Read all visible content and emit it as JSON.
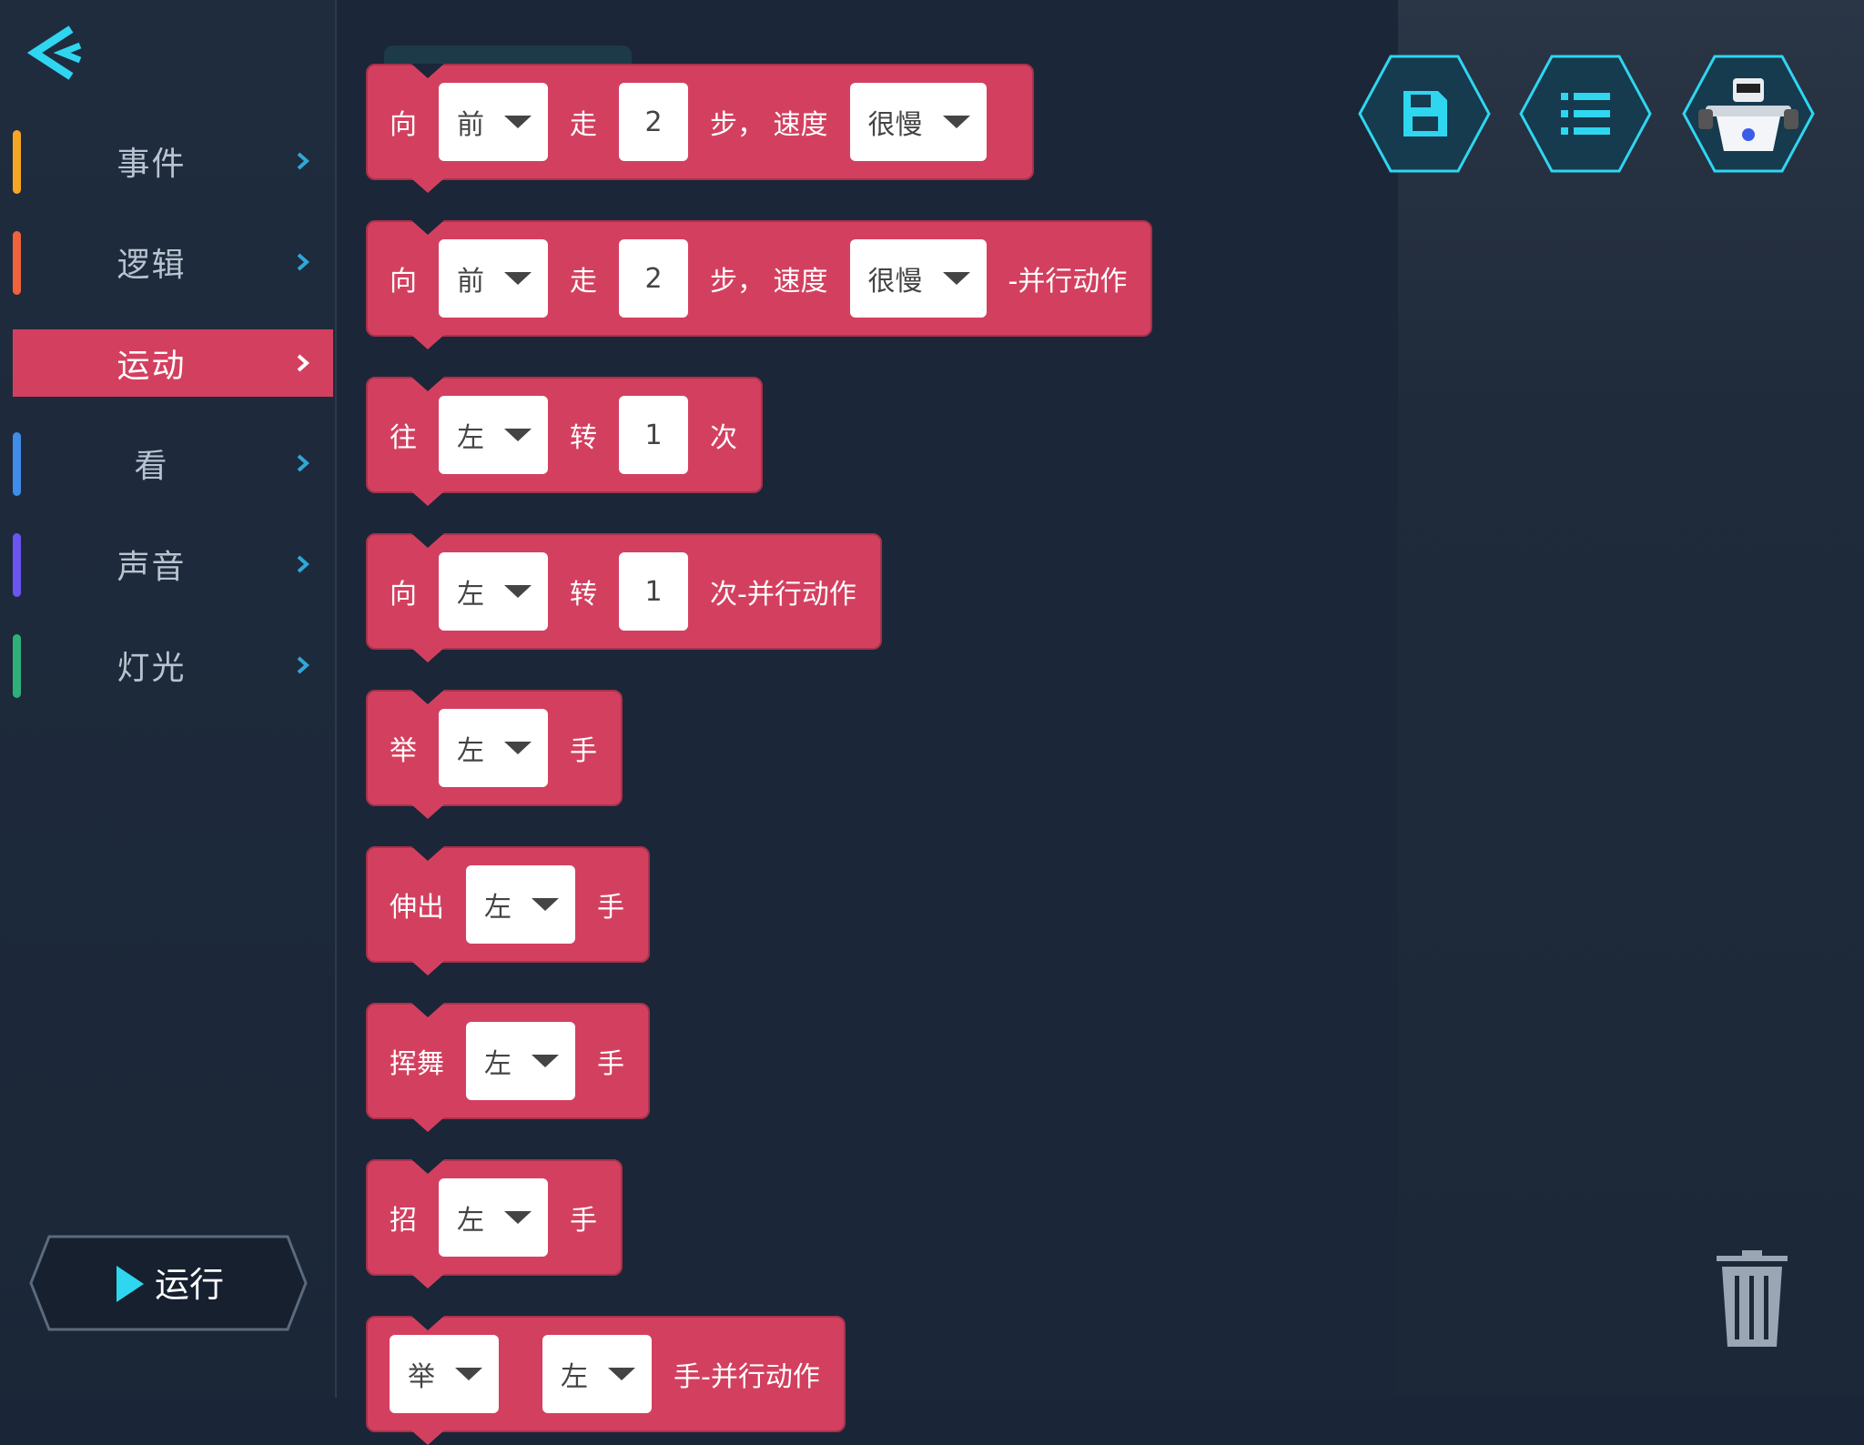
{
  "sidebar": {
    "categories": [
      {
        "label": "事件",
        "color": "#f5a623"
      },
      {
        "label": "逻辑",
        "color": "#f0623a"
      },
      {
        "label": "运动",
        "color": "#d3405f",
        "active": true
      },
      {
        "label": "看",
        "color": "#3f8de8"
      },
      {
        "label": "声音",
        "color": "#6a55f0"
      },
      {
        "label": "灯光",
        "color": "#2fb07a"
      }
    ],
    "run_label": "运行"
  },
  "toolbar": {
    "icons": [
      "save-icon",
      "list-icon",
      "robot-avatar-icon"
    ],
    "accent": "#2fd6f0"
  },
  "blocks": [
    {
      "parts": [
        {
          "t": "text",
          "v": "向"
        },
        {
          "t": "dropdown",
          "v": "前"
        },
        {
          "t": "text",
          "v": "走"
        },
        {
          "t": "number",
          "v": "2"
        },
        {
          "t": "text",
          "v": "步，  速度"
        },
        {
          "t": "dropdown",
          "v": "很慢"
        }
      ]
    },
    {
      "parts": [
        {
          "t": "text",
          "v": "向"
        },
        {
          "t": "dropdown",
          "v": "前"
        },
        {
          "t": "text",
          "v": "走"
        },
        {
          "t": "number",
          "v": "2"
        },
        {
          "t": "text",
          "v": "步，  速度"
        },
        {
          "t": "dropdown",
          "v": "很慢"
        },
        {
          "t": "text",
          "v": "-并行动作"
        }
      ]
    },
    {
      "parts": [
        {
          "t": "text",
          "v": "往"
        },
        {
          "t": "dropdown",
          "v": "左"
        },
        {
          "t": "text",
          "v": "转"
        },
        {
          "t": "number",
          "v": "1"
        },
        {
          "t": "text",
          "v": "次"
        }
      ]
    },
    {
      "parts": [
        {
          "t": "text",
          "v": "向"
        },
        {
          "t": "dropdown",
          "v": "左"
        },
        {
          "t": "text",
          "v": "转"
        },
        {
          "t": "number",
          "v": "1"
        },
        {
          "t": "text",
          "v": "次-并行动作"
        }
      ]
    },
    {
      "parts": [
        {
          "t": "text",
          "v": "举"
        },
        {
          "t": "dropdown",
          "v": "左"
        },
        {
          "t": "text",
          "v": "手"
        }
      ]
    },
    {
      "parts": [
        {
          "t": "text",
          "v": "伸出"
        },
        {
          "t": "dropdown",
          "v": "左"
        },
        {
          "t": "text",
          "v": "手"
        }
      ]
    },
    {
      "parts": [
        {
          "t": "text",
          "v": "挥舞"
        },
        {
          "t": "dropdown",
          "v": "左"
        },
        {
          "t": "text",
          "v": "手"
        }
      ]
    },
    {
      "parts": [
        {
          "t": "text",
          "v": "招"
        },
        {
          "t": "dropdown",
          "v": "左"
        },
        {
          "t": "text",
          "v": "手"
        }
      ]
    },
    {
      "parts": [
        {
          "t": "dropdown",
          "v": "举"
        },
        {
          "t": "dropdown",
          "v": "左"
        },
        {
          "t": "text",
          "v": "手-并行动作"
        }
      ]
    }
  ]
}
